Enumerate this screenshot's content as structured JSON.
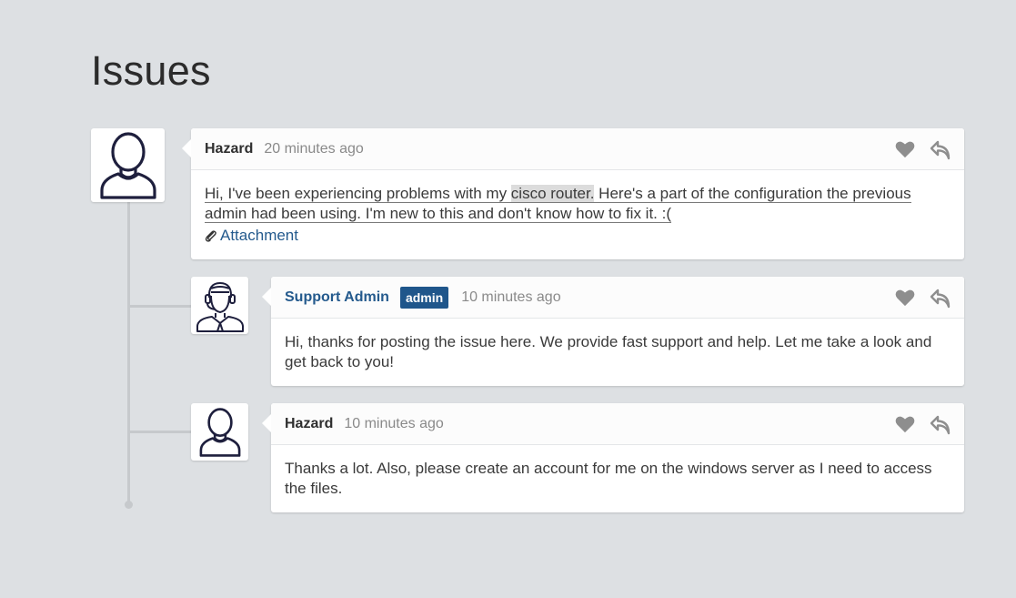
{
  "page": {
    "title": "Issues"
  },
  "icons": {
    "like": "heart-icon",
    "reply": "reply-arrow-icon",
    "attachment": "paperclip-icon"
  },
  "colors": {
    "staff_name": "#245a8d",
    "badge_bg": "#1f568b",
    "background": "#dde0e3"
  },
  "comments": [
    {
      "author": "Hazard",
      "time": "20 minutes ago",
      "avatar": "user-avatar",
      "text_before": "Hi, I've been experiencing problems with my ",
      "highlight": "cisco router.",
      "text_after": " Here's a part of the configuration the previous admin had been using. I'm new to this and don't know how to fix it. :(",
      "attachment_label": "Attachment"
    },
    {
      "author": "Support Admin",
      "badge": "admin",
      "time": "10 minutes ago",
      "avatar": "support-agent-avatar",
      "text": "Hi, thanks for posting the issue here. We provide fast support and help. Let me take a look and get back to you!"
    },
    {
      "author": "Hazard",
      "time": "10 minutes ago",
      "avatar": "user-avatar",
      "text": "Thanks a lot. Also, please create an account for me on the windows server as I need to access the files."
    }
  ]
}
